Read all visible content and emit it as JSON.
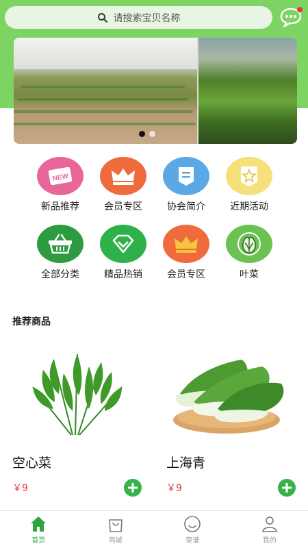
{
  "search": {
    "placeholder": "请搜索宝贝名称"
  },
  "header": {
    "message_icon": "chat-bubble-icon",
    "has_unread": true
  },
  "banner": {
    "slides": 2,
    "active_slide": 1
  },
  "categories": [
    {
      "label": "新品推荐",
      "icon": "new-badge-icon",
      "color": "#e9669a"
    },
    {
      "label": "会员专区",
      "icon": "crown-icon",
      "color": "#ef6b3c"
    },
    {
      "label": "协会简介",
      "icon": "document-icon",
      "color": "#5aa8e6"
    },
    {
      "label": "近期活动",
      "icon": "star-flag-icon",
      "color": "#f5e07a"
    },
    {
      "label": "全部分类",
      "icon": "basket-icon",
      "color": "#2d9c41"
    },
    {
      "label": "精品热销",
      "icon": "diamond-icon",
      "color": "#2eb04b"
    },
    {
      "label": "会员专区",
      "icon": "crown-icon",
      "color": "#ef6b3c"
    },
    {
      "label": "叶菜",
      "icon": "leafy-vegetable-icon",
      "color": "#6cc153"
    }
  ],
  "section": {
    "title": "推荐商品"
  },
  "products": [
    {
      "name": "空心菜",
      "price": "￥9",
      "image": "water-spinach-image"
    },
    {
      "name": "上海青",
      "price": "￥9",
      "image": "bok-choy-image"
    }
  ],
  "tabs": [
    {
      "label": "首页",
      "icon": "home-icon",
      "active": true
    },
    {
      "label": "商城",
      "icon": "shopping-bag-icon",
      "active": false
    },
    {
      "label": "菜谱",
      "icon": "smile-face-icon",
      "active": false
    },
    {
      "label": "我的",
      "icon": "user-icon",
      "active": false
    }
  ],
  "colors": {
    "brand_green": "#7ed463",
    "accent_green": "#2ea43f",
    "price_red": "#e23b3b"
  }
}
